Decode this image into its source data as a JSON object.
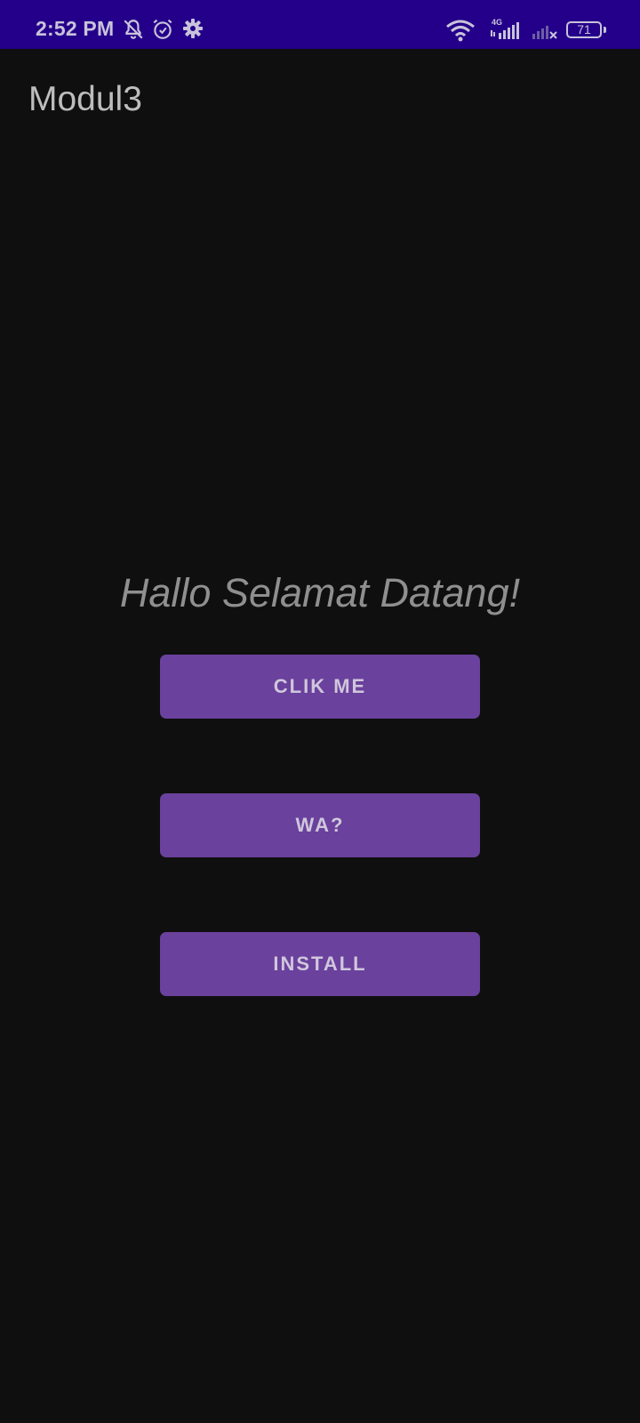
{
  "status_bar": {
    "time": "2:52 PM",
    "network_label": "4G",
    "battery_level": "71",
    "left_icons": [
      "notifications-off-icon",
      "alarm-icon",
      "settings-icon"
    ],
    "right_icons": [
      "wifi-icon",
      "cellular-signal-icon",
      "cellular-signal-no-service-icon",
      "battery-icon"
    ],
    "background_color": "#24008a"
  },
  "app_bar": {
    "title": "Modul3"
  },
  "main": {
    "greeting": "Hallo Selamat Datang!",
    "buttons": [
      {
        "label": "CLIK ME"
      },
      {
        "label": "WA?"
      },
      {
        "label": "INSTALL"
      }
    ],
    "button_color": "#6a419c",
    "background_color": "#0f0f0f"
  }
}
